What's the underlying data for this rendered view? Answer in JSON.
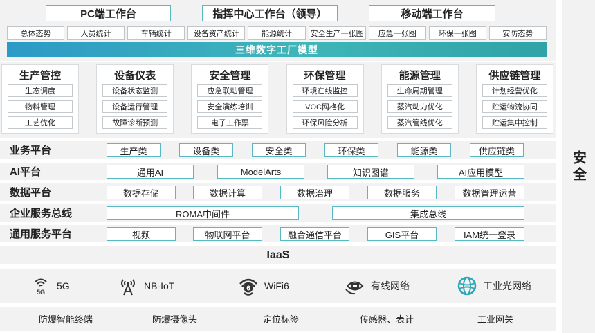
{
  "workstations": [
    "PC端工作台",
    "指挥中心工作台（领导）",
    "移动端工作台"
  ],
  "tabs": [
    "总体态势",
    "人员统计",
    "车辆统计",
    "设备资产统计",
    "能源统计",
    "安全生产一张图",
    "应急一张图",
    "环保一张图",
    "安防态势"
  ],
  "model_bar": "三维数字工厂模型",
  "domains": [
    {
      "title": "生产管控",
      "items": [
        "生态调度",
        "物料管理",
        "工艺优化"
      ]
    },
    {
      "title": "设备仪表",
      "items": [
        "设备状态监测",
        "设备运行管理",
        "故障诊断预测"
      ]
    },
    {
      "title": "安全管理",
      "items": [
        "应急联动管理",
        "安全演练培训",
        "电子工作票"
      ]
    },
    {
      "title": "环保管理",
      "items": [
        "环境在线监控",
        "VOC网格化",
        "环保风险分析"
      ]
    },
    {
      "title": "能源管理",
      "items": [
        "生命周期管理",
        "蒸汽动力优化",
        "蒸汽管线优化"
      ]
    },
    {
      "title": "供应链管理",
      "items": [
        "计划经营优化",
        "贮运物流协同",
        "贮运集中控制"
      ]
    }
  ],
  "layers": [
    {
      "title": "业务平台",
      "items": [
        "生产类",
        "设备类",
        "安全类",
        "环保类",
        "能源类",
        "供应链类"
      ]
    },
    {
      "title": "AI平台",
      "items": [
        "通用AI",
        "ModelArts",
        "知识图谱",
        "AI应用模型"
      ]
    },
    {
      "title": "数据平台",
      "items": [
        "数据存储",
        "数据计算",
        "数据治理",
        "数据服务",
        "数据管理运营"
      ]
    },
    {
      "title": "企业服务总线",
      "items": [
        "ROMA中间件",
        "集成总线"
      ]
    },
    {
      "title": "通用服务平台",
      "items": [
        "视频",
        "物联网平台",
        "融合通信平台",
        "GIS平台",
        "IAM统一登录"
      ]
    }
  ],
  "iaas": "IaaS",
  "networks": [
    {
      "label": "5G",
      "icon": "5g-signal-icon",
      "badge": "5G"
    },
    {
      "label": "NB-IoT",
      "icon": "antenna-tower-icon"
    },
    {
      "label": "WiFi6",
      "icon": "wifi6-icon",
      "badge": "6"
    },
    {
      "label": "有线网络",
      "icon": "wired-network-icon"
    },
    {
      "label": "工业光网络",
      "icon": "optical-network-icon"
    }
  ],
  "devices": [
    "防爆智能终端",
    "防爆摄像头",
    "定位标签",
    "传感器、表计",
    "工业网关"
  ],
  "security": "安全",
  "colors": {
    "accent": "#59b9c3",
    "panel": "#f2f2f2",
    "model_bar_start": "#2b9ac7",
    "model_bar_end": "#3fb6b8",
    "icon_dark": "#333333",
    "icon_teal": "#2aa7b8"
  }
}
